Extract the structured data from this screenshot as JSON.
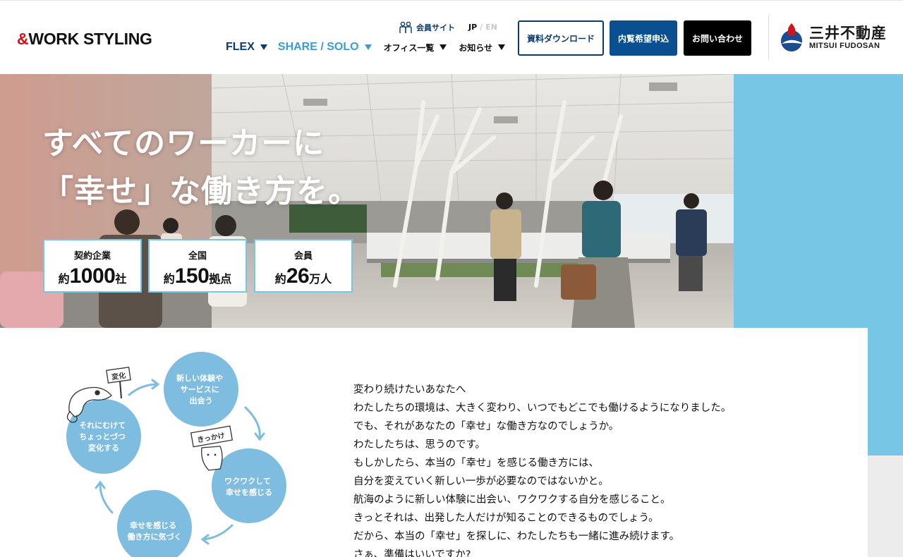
{
  "header": {
    "logo": {
      "amp": "&",
      "text": "WORK STYLING"
    },
    "member_site": "会員サイト",
    "lang": {
      "jp": "JP",
      "separator": "/",
      "en": "EN"
    },
    "nav": {
      "flex": "FLEX",
      "share_solo": "SHARE / SOLO",
      "offices": "オフィス一覧",
      "news": "お知らせ"
    },
    "buttons": {
      "download": "資料ダウンロード",
      "viewing": "内覧希望申込",
      "contact": "お問い合わせ"
    },
    "brand": {
      "jp": "三井不動産",
      "en": "MITSUI FUDOSAN"
    }
  },
  "hero": {
    "line1": "すべてのワーカーに",
    "line2": "「幸せ」な働き方を。",
    "stats": [
      {
        "label": "契約企業",
        "prefix": "約",
        "number": "1000",
        "suffix": "社"
      },
      {
        "label": "全国",
        "prefix": "約",
        "number": "150",
        "suffix": "拠点"
      },
      {
        "label": "会員",
        "prefix": "約",
        "number": "26",
        "suffix": "万人"
      }
    ]
  },
  "cycle": {
    "step1": [
      "新しい体験や",
      "サービスに",
      "出会う"
    ],
    "step2": [
      "ワクワクして",
      "幸せを感じる"
    ],
    "step3": [
      "幸せを感じる",
      "働き方に気づく"
    ],
    "step4": [
      "それにむけて",
      "ちょっとづつ",
      "変化する"
    ],
    "sign_change": "変化",
    "sign_trigger": "きっかけ"
  },
  "intro": {
    "lines": [
      "変わり続けたいあなたへ",
      "わたしたちの環境は、大きく変わり、いつでもどこでも働けるようになりました。",
      "でも、それがあなたの「幸せ」な働き方なのでしょうか。",
      "わたしたちは、思うのです。",
      "もしかしたら、本当の「幸せ」を感じる働き方には、",
      "自分を変えていく新しい一歩が必要なのではないかと。",
      "航海のように新しい体験に出会い、ワクワクする自分を感じること。",
      "きっとそれは、出発した人だけが知ることのできるものでしょう。",
      "だから、本当の「幸せ」を探しに、わたしたちも一緒に進み続けます。",
      "さぁ、準備はいいですか?"
    ]
  },
  "colors": {
    "navy": "#0a3b6e",
    "light_blue": "#78c6e6",
    "share_blue": "#3b9dd0",
    "brand_red": "#d4111c"
  }
}
